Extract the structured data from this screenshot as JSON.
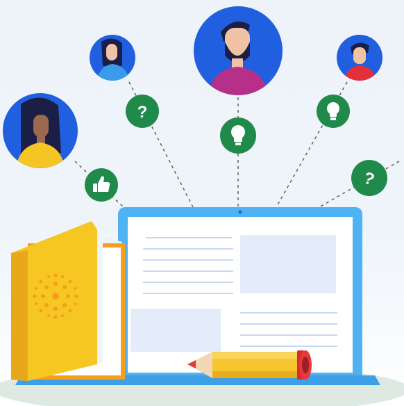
{
  "scene": {
    "icons": {
      "avatar_1": "person-avatar-icon",
      "avatar_2": "person-avatar-icon",
      "avatar_3": "person-avatar-icon",
      "avatar_4": "person-avatar-icon",
      "thumbs_up": "thumbs-up-icon",
      "question": "question-mark-icon",
      "lightbulb": "lightbulb-icon",
      "laptop": "laptop-icon",
      "book": "book-icon",
      "pencil": "pencil-icon"
    },
    "colors": {
      "background_top": "#eef3f8",
      "avatar_circle": "#1f5fe0",
      "bubble_green": "#1f8a4a",
      "laptop_frame": "#4fb2f2",
      "laptop_screen": "#ffffff",
      "book_yellow": "#f6c623",
      "pencil_yellow": "#f7c530",
      "pencil_red": "#e8393a"
    }
  }
}
